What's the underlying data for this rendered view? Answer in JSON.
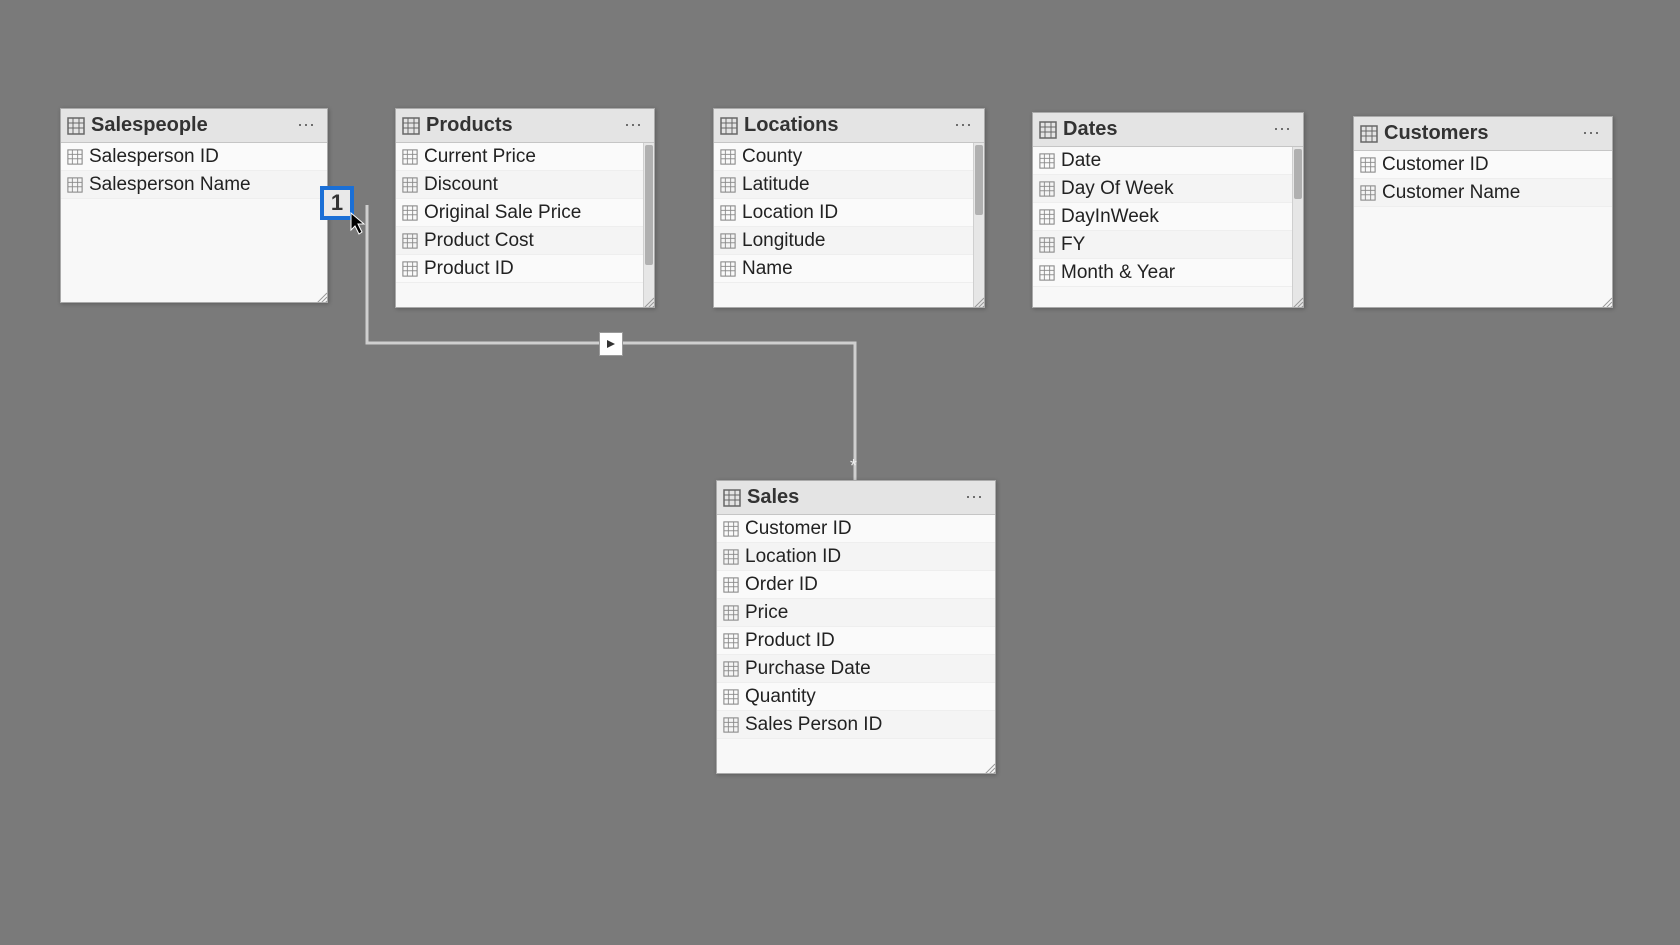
{
  "tables": {
    "salespeople": {
      "title": "Salespeople",
      "fields": [
        "Salesperson ID",
        "Salesperson Name"
      ]
    },
    "products": {
      "title": "Products",
      "fields": [
        "Current Price",
        "Discount",
        "Original Sale Price",
        "Product Cost",
        "Product ID"
      ]
    },
    "locations": {
      "title": "Locations",
      "fields": [
        "County",
        "Latitude",
        "Location ID",
        "Longitude",
        "Name"
      ]
    },
    "dates": {
      "title": "Dates",
      "fields": [
        "Date",
        "Day Of Week",
        "DayInWeek",
        "FY",
        "Month & Year"
      ]
    },
    "customers": {
      "title": "Customers",
      "fields": [
        "Customer ID",
        "Customer Name"
      ]
    },
    "sales": {
      "title": "Sales",
      "fields": [
        "Customer ID",
        "Location ID",
        "Order ID",
        "Price",
        "Product ID",
        "Purchase Date",
        "Quantity",
        "Sales Person ID"
      ]
    }
  },
  "relationship": {
    "cardinality_from": "1",
    "cardinality_to": "*"
  },
  "ui": {
    "more_glyph": "⋯"
  }
}
